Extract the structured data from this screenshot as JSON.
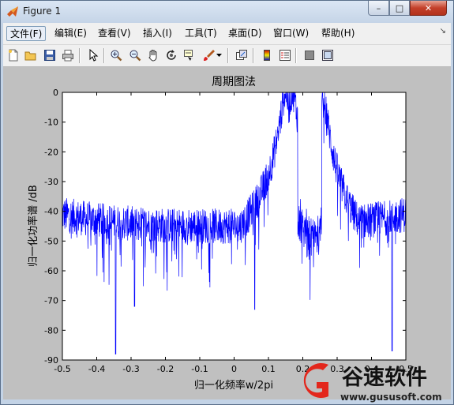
{
  "window": {
    "title": "Figure 1",
    "min_symbol": "–",
    "max_symbol": "□",
    "close_symbol": "✕"
  },
  "menu": {
    "items": [
      {
        "label": "文件(F)",
        "active": true
      },
      {
        "label": "编辑(E)"
      },
      {
        "label": "查看(V)"
      },
      {
        "label": "插入(I)"
      },
      {
        "label": "工具(T)"
      },
      {
        "label": "桌面(D)"
      },
      {
        "label": "窗口(W)"
      },
      {
        "label": "帮助(H)"
      }
    ],
    "overflow_arrow": "↘"
  },
  "toolbar": {
    "icons": [
      "new-file-icon",
      "open-folder-icon",
      "save-icon",
      "print-icon",
      "pointer-icon",
      "zoom-in-icon",
      "zoom-out-icon",
      "pan-hand-icon",
      "rotate-3d-icon",
      "data-cursor-icon",
      "brush-icon",
      "brush-dropdown-icon",
      "link-plot-icon",
      "colorbar-icon",
      "legend-icon",
      "hide-plot-tools-icon",
      "show-plot-tools-icon"
    ]
  },
  "chart_data": {
    "type": "line",
    "title": "周期图法",
    "xlabel": "归一化频率w/2pi",
    "ylabel": "归一化功率谱 /dB",
    "xlim": [
      -0.5,
      0.5
    ],
    "ylim": [
      -90,
      0
    ],
    "xticks": [
      "-0.5",
      "-0.4",
      "-0.3",
      "-0.2",
      "-0.1",
      "0",
      "0.1",
      "0.2",
      "0.3",
      "0.4",
      "0.5"
    ],
    "yticks": [
      "0",
      "-10",
      "-20",
      "-30",
      "-40",
      "-50",
      "-60",
      "-70",
      "-80",
      "-90"
    ],
    "series": [
      {
        "color": "#0000ff",
        "description_points": {
          "noise_floor_db": -45,
          "peaks": [
            {
              "x": 0.15,
              "y": 0
            },
            {
              "x": 0.17,
              "y": 0
            },
            {
              "x": 0.26,
              "y": -3
            }
          ],
          "deep_dips": [
            {
              "x": -0.345,
              "y": -88
            },
            {
              "x": 0.46,
              "y": -87
            },
            {
              "x": -0.29,
              "y": -72
            },
            {
              "x": 0.06,
              "y": -73
            }
          ]
        }
      }
    ],
    "grid": false
  },
  "watermark": {
    "brand": "谷速软件",
    "url": "www.gususoft.com"
  }
}
